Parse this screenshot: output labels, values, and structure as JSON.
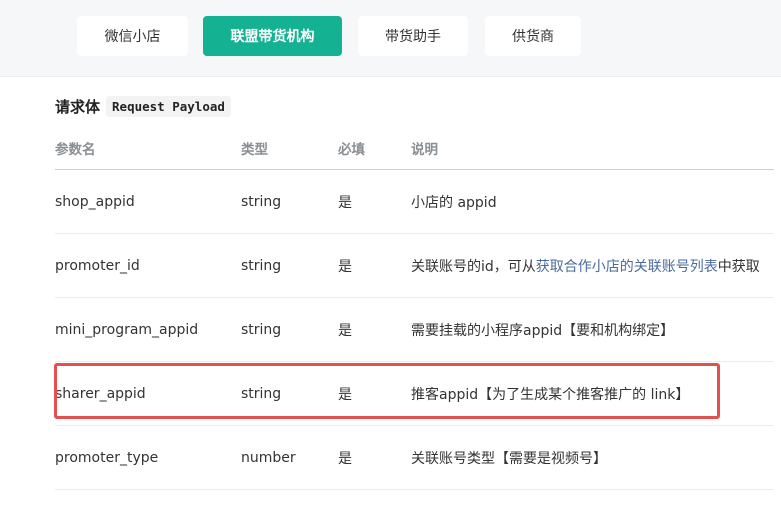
{
  "tabs": [
    {
      "label": "微信小店"
    },
    {
      "label": "联盟带货机构"
    },
    {
      "label": "带货助手"
    },
    {
      "label": "供货商"
    }
  ],
  "section": {
    "title": "请求体",
    "code": "Request Payload"
  },
  "table": {
    "headers": [
      "参数名",
      "类型",
      "必填",
      "说明"
    ],
    "rows": [
      {
        "name": "shop_appid",
        "type": "string",
        "required": "是",
        "desc": "小店的 appid"
      },
      {
        "name": "promoter_id",
        "type": "string",
        "required": "是",
        "desc_pre": "关联账号的id，可从",
        "desc_link": "获取合作小店的关联账号列表",
        "desc_post": "中获取"
      },
      {
        "name": "mini_program_appid",
        "type": "string",
        "required": "是",
        "desc": "需要挂载的小程序appid【要和机构绑定】"
      },
      {
        "name": "sharer_appid",
        "type": "string",
        "required": "是",
        "desc": "推客appid【为了生成某个推客推广的 link】"
      },
      {
        "name": "promoter_type",
        "type": "number",
        "required": "是",
        "desc": "关联账号类型【需要是视频号】"
      }
    ]
  },
  "colors": {
    "accent": "#14b193",
    "highlight": "#e44f4f",
    "link": "#4b6a9e"
  }
}
